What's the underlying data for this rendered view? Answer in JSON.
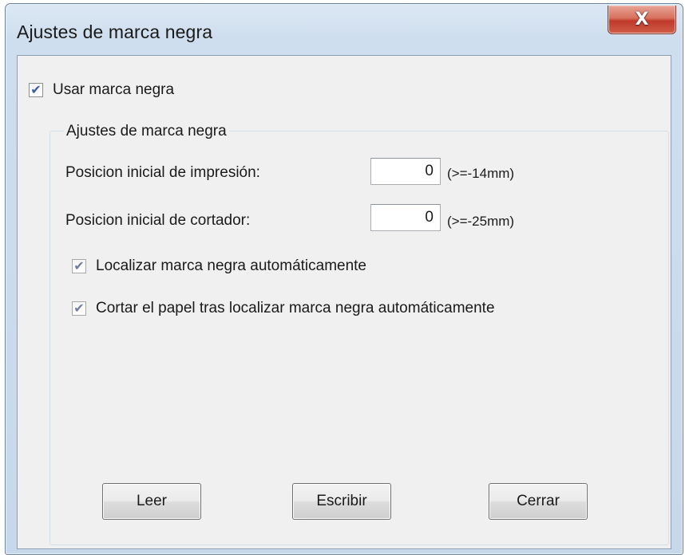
{
  "window": {
    "title": "Ajustes de marca negra",
    "close_icon": "close-icon",
    "close_glyph": "X"
  },
  "use_black_mark": {
    "label": "Usar marca negra",
    "checked": true
  },
  "group": {
    "legend": "Ajustes de marca negra",
    "print_start": {
      "label": "Posicion inicial de impresión:",
      "value": "0",
      "hint": "(>=-14mm)"
    },
    "cutter_start": {
      "label": "Posicion inicial de cortador:",
      "value": "0",
      "hint": "(>=-25mm)"
    },
    "auto_locate": {
      "label": "Localizar marca negra automáticamente",
      "checked": true
    },
    "cut_after_locate": {
      "label": "Cortar el papel tras localizar marca negra automáticamente",
      "checked": true
    }
  },
  "buttons": {
    "read": "Leer",
    "write": "Escribir",
    "close": "Cerrar"
  },
  "check_glyph": "✔"
}
